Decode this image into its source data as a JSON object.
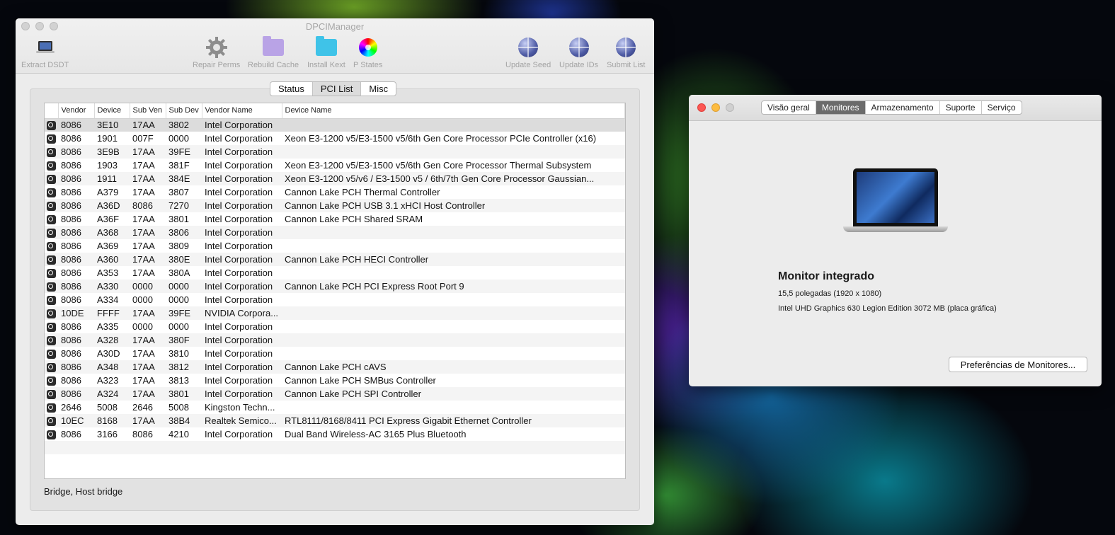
{
  "main_window": {
    "title": "DPCIManager",
    "toolbar": {
      "extract_dsdt": "Extract DSDT",
      "repair_perms": "Repair Perms",
      "rebuild_cache": "Rebuild Cache",
      "install_kext": "Install Kext",
      "p_states": "P States",
      "update_seed": "Update Seed",
      "update_ids": "Update IDs",
      "submit_list": "Submit List"
    },
    "tabs": {
      "status": "Status",
      "pci_list": "PCI List",
      "misc": "Misc",
      "selected": "PCI List"
    },
    "columns": {
      "vendor": "Vendor",
      "device": "Device",
      "sub_ven": "Sub Ven",
      "sub_dev": "Sub Dev",
      "vendor_name": "Vendor Name",
      "device_name": "Device Name"
    },
    "rows": [
      [
        "8086",
        "3E10",
        "17AA",
        "3802",
        "Intel Corporation",
        ""
      ],
      [
        "8086",
        "1901",
        "007F",
        "0000",
        "Intel Corporation",
        "Xeon E3-1200 v5/E3-1500 v5/6th Gen Core Processor PCIe Controller (x16)"
      ],
      [
        "8086",
        "3E9B",
        "17AA",
        "39FE",
        "Intel Corporation",
        ""
      ],
      [
        "8086",
        "1903",
        "17AA",
        "381F",
        "Intel Corporation",
        "Xeon E3-1200 v5/E3-1500 v5/6th Gen Core Processor Thermal Subsystem"
      ],
      [
        "8086",
        "1911",
        "17AA",
        "384E",
        "Intel Corporation",
        "Xeon E3-1200 v5/v6 / E3-1500 v5 / 6th/7th Gen Core Processor Gaussian..."
      ],
      [
        "8086",
        "A379",
        "17AA",
        "3807",
        "Intel Corporation",
        "Cannon Lake PCH Thermal Controller"
      ],
      [
        "8086",
        "A36D",
        "8086",
        "7270",
        "Intel Corporation",
        "Cannon Lake PCH USB 3.1 xHCI Host Controller"
      ],
      [
        "8086",
        "A36F",
        "17AA",
        "3801",
        "Intel Corporation",
        "Cannon Lake PCH Shared SRAM"
      ],
      [
        "8086",
        "A368",
        "17AA",
        "3806",
        "Intel Corporation",
        ""
      ],
      [
        "8086",
        "A369",
        "17AA",
        "3809",
        "Intel Corporation",
        ""
      ],
      [
        "8086",
        "A360",
        "17AA",
        "380E",
        "Intel Corporation",
        "Cannon Lake PCH HECI Controller"
      ],
      [
        "8086",
        "A353",
        "17AA",
        "380A",
        "Intel Corporation",
        ""
      ],
      [
        "8086",
        "A330",
        "0000",
        "0000",
        "Intel Corporation",
        "Cannon Lake PCH PCI Express Root Port 9"
      ],
      [
        "8086",
        "A334",
        "0000",
        "0000",
        "Intel Corporation",
        ""
      ],
      [
        "10DE",
        "FFFF",
        "17AA",
        "39FE",
        "NVIDIA Corpora...",
        ""
      ],
      [
        "8086",
        "A335",
        "0000",
        "0000",
        "Intel Corporation",
        ""
      ],
      [
        "8086",
        "A328",
        "17AA",
        "380F",
        "Intel Corporation",
        ""
      ],
      [
        "8086",
        "A30D",
        "17AA",
        "3810",
        "Intel Corporation",
        ""
      ],
      [
        "8086",
        "A348",
        "17AA",
        "3812",
        "Intel Corporation",
        "Cannon Lake PCH cAVS"
      ],
      [
        "8086",
        "A323",
        "17AA",
        "3813",
        "Intel Corporation",
        "Cannon Lake PCH SMBus Controller"
      ],
      [
        "8086",
        "A324",
        "17AA",
        "3801",
        "Intel Corporation",
        "Cannon Lake PCH SPI Controller"
      ],
      [
        "2646",
        "5008",
        "2646",
        "5008",
        "Kingston Techn...",
        ""
      ],
      [
        "10EC",
        "8168",
        "17AA",
        "38B4",
        "Realtek Semico...",
        "RTL8111/8168/8411 PCI Express Gigabit Ethernet Controller"
      ],
      [
        "8086",
        "3166",
        "8086",
        "4210",
        "Intel Corporation",
        "Dual Band Wireless-AC 3165 Plus Bluetooth"
      ]
    ],
    "status_text": "Bridge, Host bridge"
  },
  "about_window": {
    "tabs": [
      "Visão geral",
      "Monitores",
      "Armazenamento",
      "Suporte",
      "Serviço"
    ],
    "selected_tab": "Monitores",
    "monitor_name": "Monitor integrado",
    "monitor_size": "15,5 polegadas (1920 x 1080)",
    "graphics": "Intel UHD Graphics 630 Legion Edition 3072 MB (placa gráfica)",
    "prefs_button": "Preferências de Monitores..."
  }
}
